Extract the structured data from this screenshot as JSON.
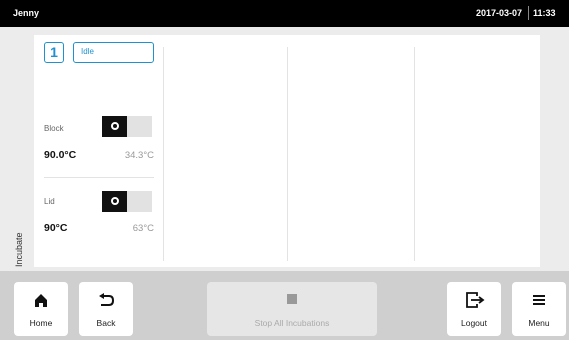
{
  "topbar": {
    "user": "Jenny",
    "date": "2017-03-07",
    "time": "11:33"
  },
  "sidebar": {
    "section_label": "Incubate"
  },
  "slot": {
    "number": "1",
    "status": "Idle",
    "block": {
      "label": "Block",
      "set_temp": "90.0°C",
      "actual_temp": "34.3°C",
      "toggle_on": false
    },
    "lid": {
      "label": "Lid",
      "set_temp": "90°C",
      "actual_temp": "63°C",
      "toggle_on": false
    }
  },
  "toolbar": {
    "home_label": "Home",
    "back_label": "Back",
    "stop_label": "Stop All Incubations",
    "logout_label": "Logout",
    "menu_label": "Menu"
  },
  "icons": {
    "home": "home-icon",
    "back": "back-arrow-icon",
    "stop": "stop-square-icon",
    "logout": "logout-icon",
    "menu": "menu-icon"
  },
  "colors": {
    "accent": "#1f90d0",
    "topbar": "#000000",
    "toolbar": "#cfcfcf"
  }
}
